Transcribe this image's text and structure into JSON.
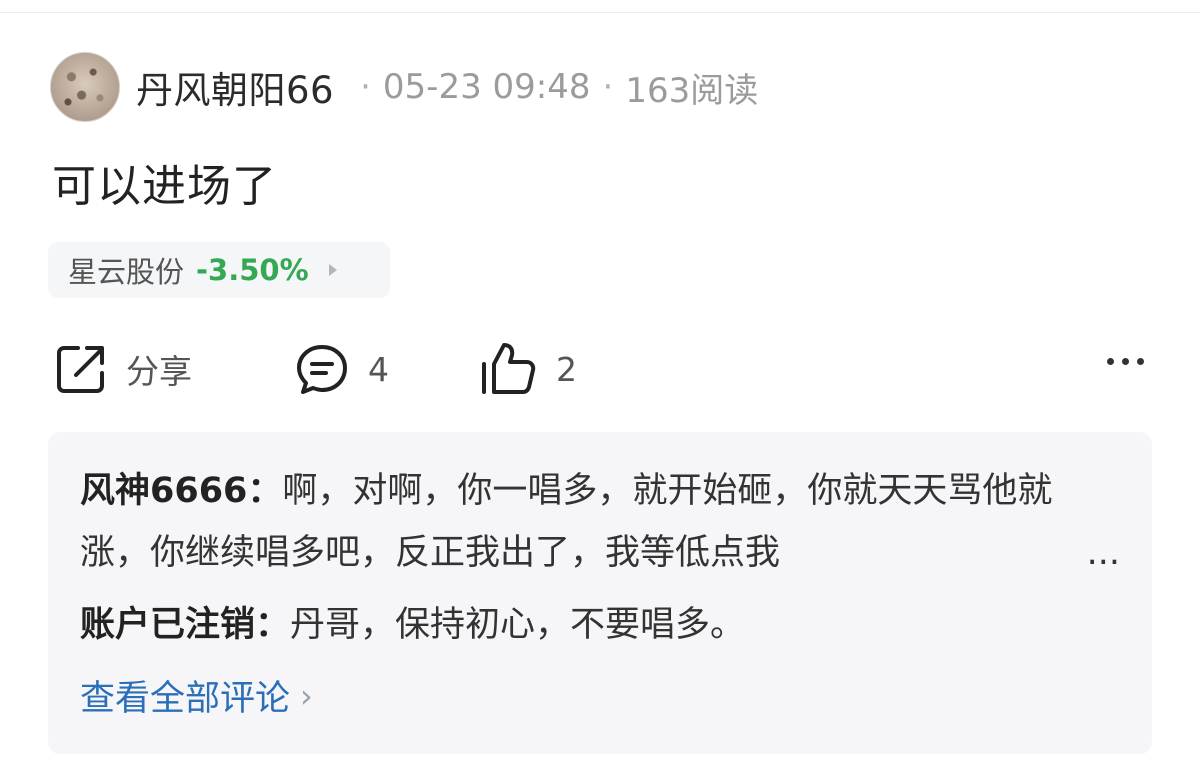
{
  "post": {
    "author": "丹风朝阳66",
    "timestamp": "05-23 09:48",
    "reads": "163阅读",
    "text": "可以进场了",
    "avatar_icon": "avatar-photo"
  },
  "stock": {
    "name": "星云股份",
    "change": "-3.50%",
    "change_color": "#34a853"
  },
  "actions": {
    "share_label": "分享",
    "comment_count": "4",
    "like_count": "2",
    "more_icon": "more-horizontal-icon"
  },
  "comments": [
    {
      "name": "风神6666：",
      "text": "啊，对啊，你一唱多，就开始砸，你就天天骂他就涨，你继续唱多吧，反正我出了，我等低点我",
      "ellipsis": "..."
    },
    {
      "name": "账户已注销：",
      "text": "丹哥，保持初心，不要唱多。"
    }
  ],
  "view_all": {
    "label": "查看全部评论",
    "link_color": "#2a6fb8"
  }
}
